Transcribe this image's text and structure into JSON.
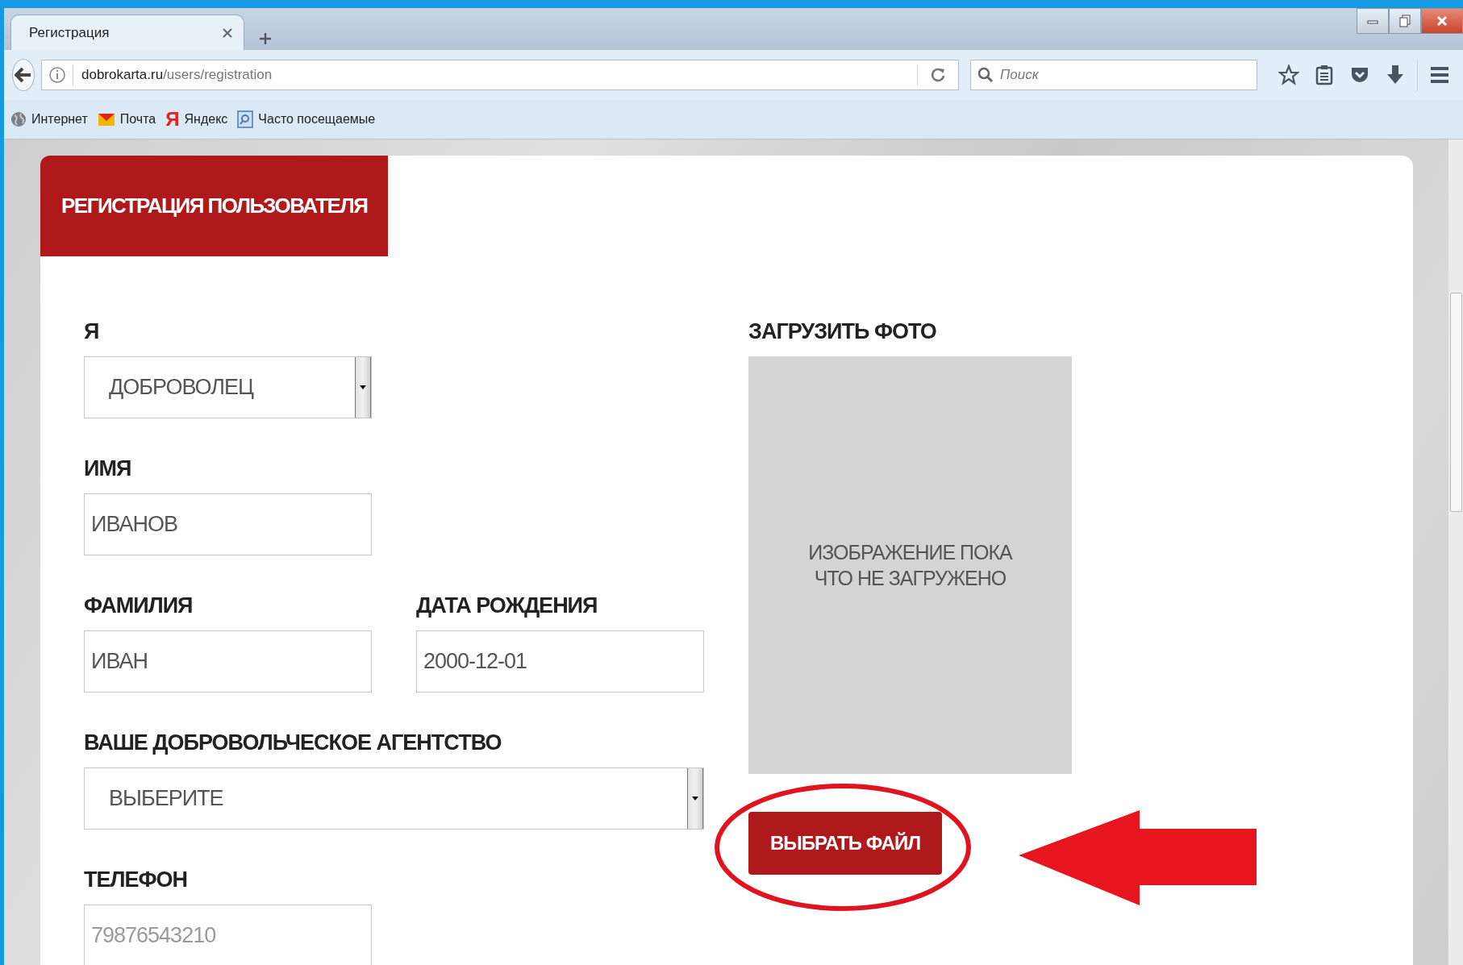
{
  "browser": {
    "tabs": [
      {
        "title": "Регистрация",
        "selected": true
      }
    ],
    "address": {
      "domain": "dobrokarta.ru",
      "path": "/users/registration"
    },
    "search": {
      "placeholder": "Поиск"
    },
    "bookmarks": [
      {
        "kind": "globe",
        "label": "Интернет"
      },
      {
        "kind": "mail",
        "label": "Почта"
      },
      {
        "kind": "letter",
        "glyph": "Я",
        "label": "Яндекс"
      },
      {
        "kind": "folder",
        "label": "Часто посещаемые"
      }
    ]
  },
  "page": {
    "title": "РЕГИСТРАЦИЯ ПОЛЬЗОВАТЕЛЯ",
    "rows": [
      [
        {
          "kind": "select",
          "label": "Я",
          "value": "ДОБРОВОЛЕЦ"
        }
      ],
      [
        {
          "kind": "text",
          "label": "ИМЯ",
          "value": "ИВАНОВ"
        }
      ],
      [
        {
          "kind": "text",
          "label": "ФАМИЛИЯ",
          "value": "ИВАН"
        },
        {
          "kind": "text",
          "label": "ДАТА РОЖДЕНИЯ",
          "value": "2000-12-01"
        }
      ],
      [
        {
          "kind": "select",
          "label": "ВАШЕ ДОБРОВОЛЬЧЕСКОЕ АГЕНТСТВО",
          "value": "ВЫБЕРИТЕ"
        }
      ],
      [
        {
          "kind": "text",
          "label": "ТЕЛЕФОН",
          "placeholder": "79876543210"
        }
      ]
    ],
    "photo": {
      "label": "ЗАГРУЗИТЬ ФОТО",
      "empty_text": "ИЗОБРАЖЕНИЕ ПОКА ЧТО НЕ ЗАГРУЖЕНО",
      "button": "ВЫБРАТЬ ФАЙЛ"
    }
  }
}
